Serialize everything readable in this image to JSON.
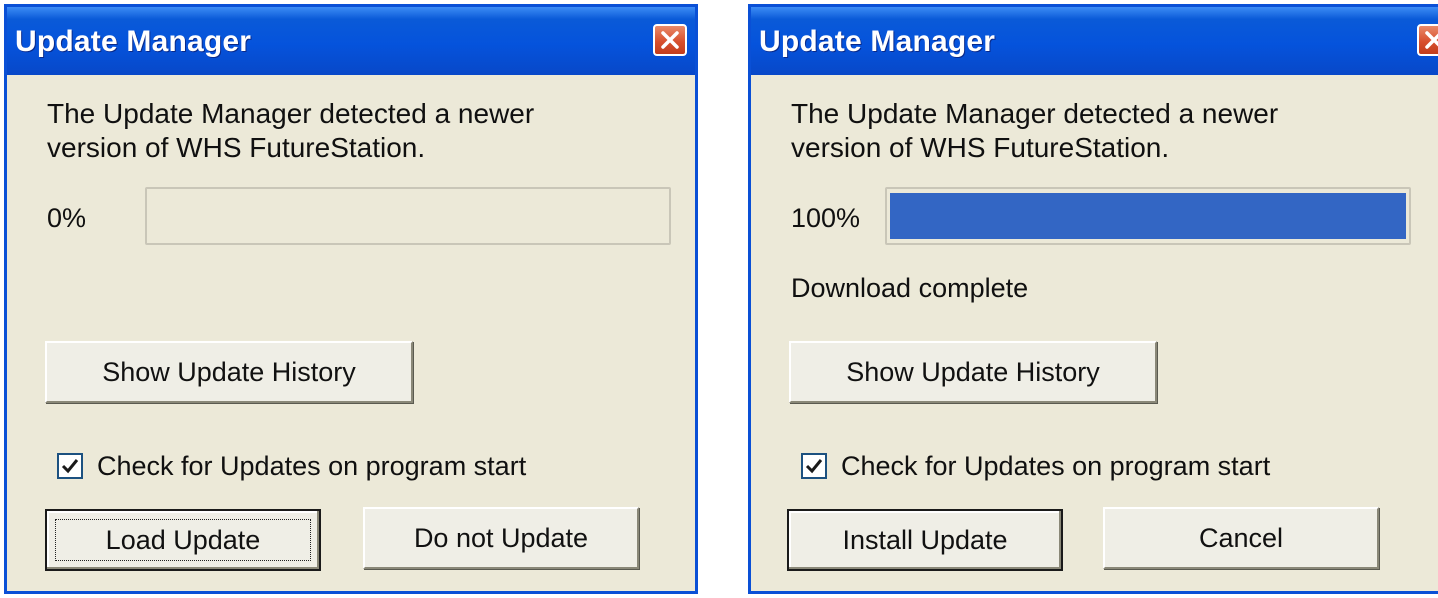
{
  "left_dialog": {
    "title": "Update Manager",
    "message_line1": "The Update Manager detected a newer",
    "message_line2": "version of WHS FutureStation.",
    "progress_label": "0%",
    "progress_value": 0,
    "status_text": "",
    "history_button": "Show Update History",
    "checkbox_label": "Check for Updates on program start",
    "checkbox_checked": true,
    "primary_button": "Load Update",
    "secondary_button": "Do not Update"
  },
  "right_dialog": {
    "title": "Update Manager",
    "message_line1": "The Update Manager detected a newer",
    "message_line2": "version of WHS FutureStation.",
    "progress_label": "100%",
    "progress_value": 100,
    "status_text": "Download complete",
    "history_button": "Show Update History",
    "checkbox_label": "Check for Updates on program start",
    "checkbox_checked": true,
    "primary_button": "Install Update",
    "secondary_button": "Cancel"
  },
  "icons": {
    "close": "close-icon",
    "check": "checkmark-icon"
  },
  "colors": {
    "titlebar": "#0553dc",
    "window_bg": "#ece9d8",
    "progress_fill": "#3366c4",
    "close_button": "#d8502e"
  }
}
